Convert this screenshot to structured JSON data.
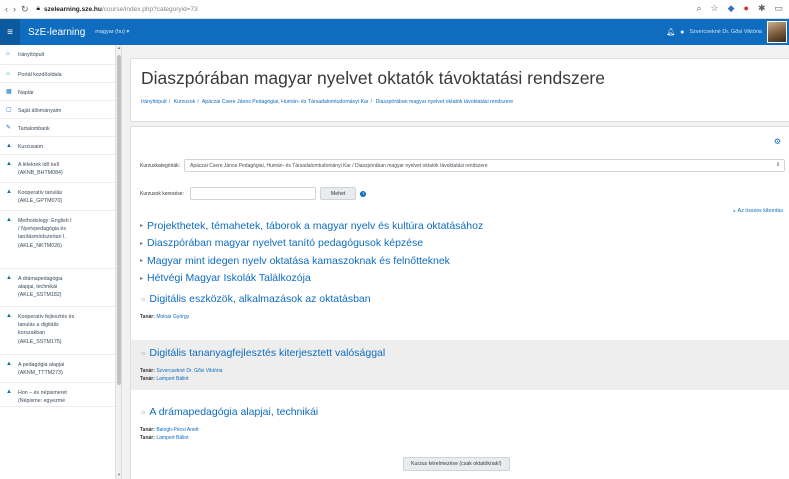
{
  "browser": {
    "host": "szelearning.sze.hu",
    "path": "/course/index.php?categoryid=73"
  },
  "navbar": {
    "brand": "SzE-learning",
    "language": "magyar (hu) ▾",
    "user_name": "Szvercsekné Dr. Gősi Viktória"
  },
  "drawer": {
    "items": [
      {
        "icon": "dashboard-icon",
        "glyph": "⌂",
        "label": "Irányítópult"
      },
      {
        "icon": "home-icon",
        "glyph": "⌂",
        "label": "Portál kezdőoldala"
      },
      {
        "icon": "calendar-icon",
        "glyph": "▦",
        "label": "Naptár"
      },
      {
        "icon": "file-icon",
        "glyph": "▢",
        "label": "Saját állományaim"
      },
      {
        "icon": "pencil-icon",
        "glyph": "✎",
        "label": "Tartalombank"
      },
      {
        "icon": "graduation-cap-icon",
        "glyph": "▲",
        "label": "Kurzusaim"
      },
      {
        "icon": "graduation-cap-icon",
        "glyph": "▲",
        "label": "A lélekrek idő kell\n(AKNB_BHTM084)"
      },
      {
        "icon": "graduation-cap-icon",
        "glyph": "▲",
        "label": "Kooperatív tanulás\n(AKLE_GPTM070)"
      },
      {
        "icon": "graduation-cap-icon",
        "glyph": "▲",
        "label": "Methodology: English I\n/ Nyelvpedagógia és\ntanításmódszertan I.\n(AKLE_NKTM026)"
      },
      {
        "icon": "graduation-cap-icon",
        "glyph": "▲",
        "label": "A drámapedagógia\nalapjai, technikái\n(AKLE_SSTM182)"
      },
      {
        "icon": "graduation-cap-icon",
        "glyph": "▲",
        "label": "Kooperatív fejlesztés és\ntanulás a digitális\nkorszakban\n(AKLE_SSTM175)"
      },
      {
        "icon": "graduation-cap-icon",
        "glyph": "▲",
        "label": "A pedagógia alapjai\n(AKNM_TTTM273)"
      },
      {
        "icon": "graduation-cap-icon",
        "glyph": "▲",
        "label": "Hon – és népismeret\n(Népisme: egyezmé"
      }
    ]
  },
  "header": {
    "title": "Diaszpórában magyar nyelvet oktatók távoktatási rendszere",
    "breadcrumb": [
      "Irányítópult",
      "Kurzusok",
      "Apáczai Csere János Pedagógiai, Humán- és Társadalomtudományi Kar",
      "Diaszpórában magyar nyelvet oktatók távoktatási rendszere"
    ]
  },
  "main": {
    "category_label": "Kurzuskategóriák:",
    "category_value": "Apáczai Csere János Pedagógiai, Humán- és Társadalomtudományi Kar / Diaszpórában magyar nyelvet oktatók távoktatási rendszere",
    "search_label": "Kurzusok keresése:",
    "search_value": "",
    "search_button": "Mehet",
    "expand_all": "Az összes kibontás",
    "subcategories": [
      "Projekthetek, témahetek, táborok a magyar nyelv és kultúra oktatásához",
      "Diaszpórában magyar nyelvet tanító pedagógusok képzése",
      "Magyar mint idegen nyelv oktatása kamaszoknak és felnőtteknek",
      "Hétvégi Magyar Iskolák Találkozója"
    ],
    "courses": [
      {
        "title": "Digitális eszközök, alkalmazások az oktatásban",
        "teachers": [
          {
            "label": "Tanár:",
            "name": "Molnár György"
          }
        ]
      },
      {
        "title": "Digitális tananyagfejlesztés kiterjesztett valósággal",
        "teachers": [
          {
            "label": "Tanár:",
            "name": "Szvercsekné Dr. Gősi Viktória"
          },
          {
            "label": "Tanár:",
            "name": "Lampert Bálint"
          }
        ]
      },
      {
        "title": "A drámapedagógia alapjai, technikái",
        "teachers": [
          {
            "label": "Tanár:",
            "name": "Balogh-Pécsi Anett"
          },
          {
            "label": "Tanár:",
            "name": "Lampert Bálint"
          }
        ]
      }
    ],
    "request_button": "Kurzus kérelmezése (csak oktatóknak!)"
  }
}
